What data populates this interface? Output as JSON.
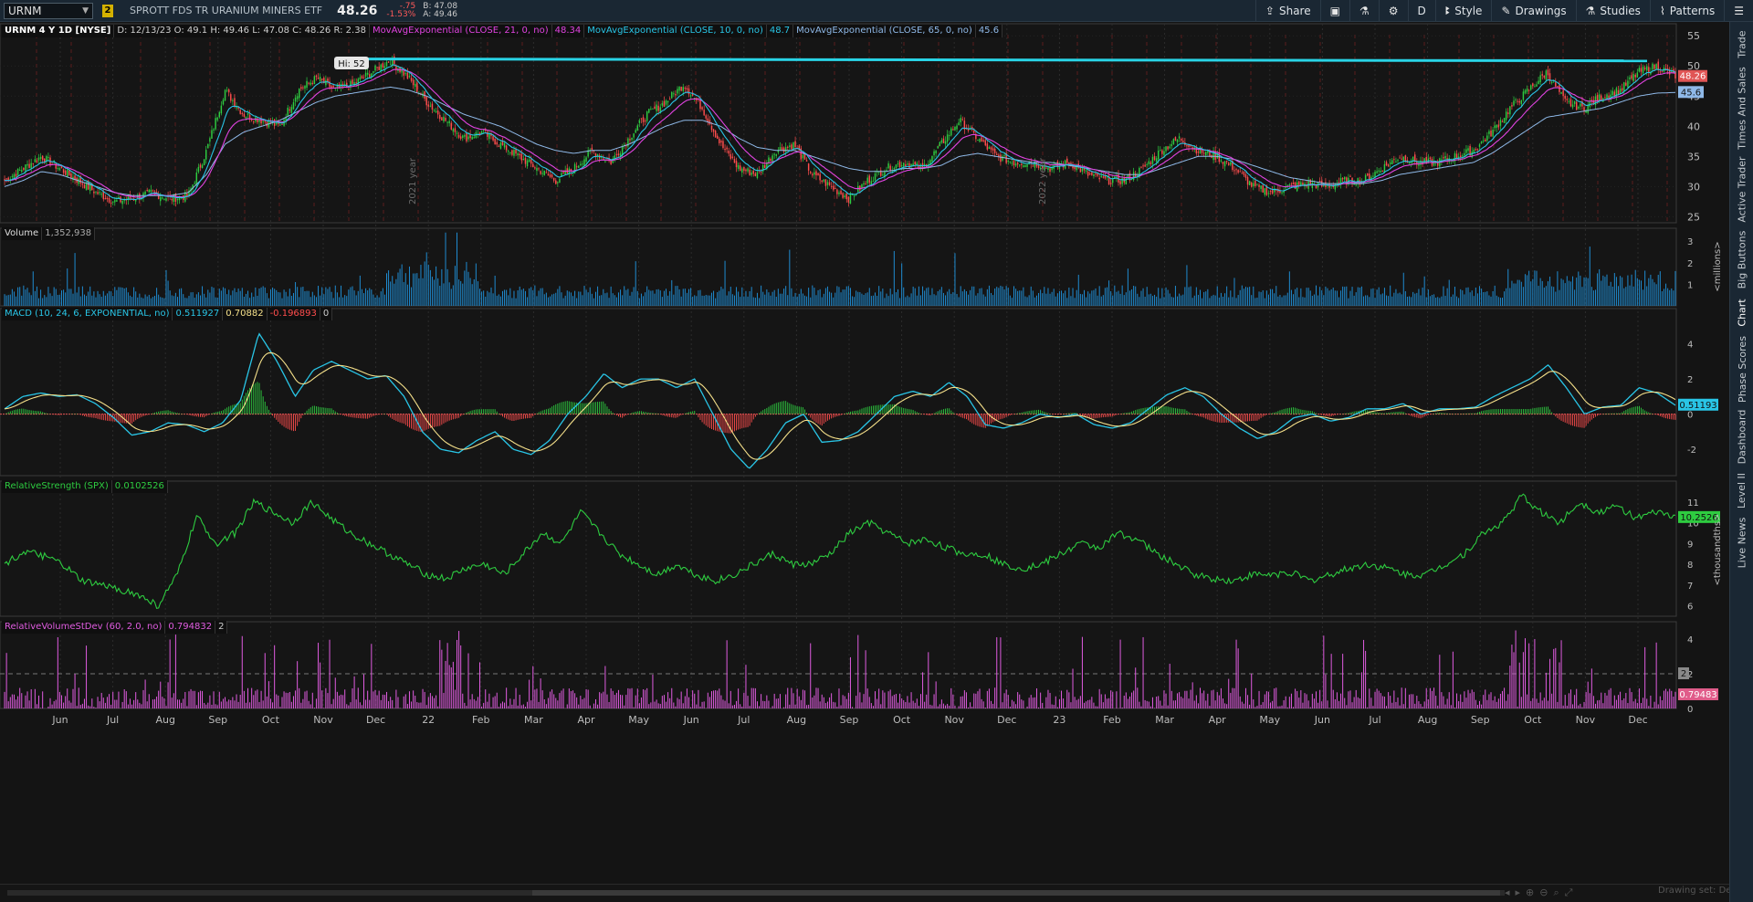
{
  "toolbar": {
    "symbol": "URNM",
    "link_badge": "2",
    "description": "SPROTT FDS TR URANIUM MINERS ETF",
    "last_price": "48.26",
    "change": "-.75",
    "change_pct": "-1.53%",
    "bid": "B: 47.08",
    "ask": "A: 49.46",
    "buttons": [
      {
        "icon": "share-icon",
        "label": "Share"
      },
      {
        "icon": "snapshot-icon",
        "label": ""
      },
      {
        "icon": "flask-icon",
        "label": ""
      },
      {
        "icon": "gear-icon",
        "label": ""
      },
      {
        "icon": "",
        "label": "D"
      },
      {
        "icon": "style-icon",
        "label": "Style"
      },
      {
        "icon": "pencil-icon",
        "label": "Drawings"
      },
      {
        "icon": "flask-icon",
        "label": "Studies"
      },
      {
        "icon": "patterns-icon",
        "label": "Patterns"
      },
      {
        "icon": "menu-icon",
        "label": ""
      }
    ]
  },
  "side_tabs": [
    "Trade",
    "Times And Sales",
    "Active Trader",
    "Big Buttons",
    "Chart",
    "Phase Scores",
    "Dashboard",
    "Level II",
    "Live News"
  ],
  "price_header": {
    "title": "URNM 4 Y 1D [NYSE]",
    "ohlc": "D: 12/13/23  O: 49.1  H: 49.46  L: 47.08  C: 48.26  R: 2.38",
    "ema21_label": "MovAvgExponential (CLOSE, 21, 0, no)",
    "ema21_value": "48.34",
    "ema10_label": "MovAvgExponential (CLOSE, 10, 0, no)",
    "ema10_value": "48.7",
    "ema65_label": "MovAvgExponential (CLOSE, 65, 0, no)",
    "ema65_value": "45.6"
  },
  "volume_header": {
    "label": "Volume",
    "value": "1,352,938"
  },
  "macd_header": {
    "label": "MACD (10, 24, 6, EXPONENTIAL, no)",
    "v1": "0.511927",
    "v2": "0.70882",
    "v3": "-0.196893",
    "v4": "0"
  },
  "rs_header": {
    "label": "RelativeStrength (SPX)",
    "value": "0.0102526"
  },
  "rv_header": {
    "label": "RelativeVolumeStDev (60, 2.0, no)",
    "v1": "0.794832",
    "v2": "2"
  },
  "annotations": {
    "hi_label": "Hi: 52"
  },
  "footer": {
    "drawing_set": "Drawing set: Default"
  },
  "colors": {
    "up": "#2ecc40",
    "down": "#ff4d4d",
    "ema10": "#29c5e6",
    "ema21": "#e043e0",
    "ema65": "#8fb9e8",
    "volume": "#1f8bd0",
    "rs": "#2ecc40",
    "rv": "#e05ce0",
    "resistance": "#29d4e6"
  },
  "chart_data": [
    {
      "type": "candlestick",
      "title": "URNM 4 Y 1D [NYSE]",
      "x_tick_labels": [
        "Jun",
        "Jul",
        "Aug",
        "Sep",
        "Oct",
        "Nov",
        "Dec",
        "22",
        "Feb",
        "Mar",
        "Apr",
        "May",
        "Jun",
        "Jul",
        "Aug",
        "Sep",
        "Oct",
        "Nov",
        "Dec",
        "23",
        "Feb",
        "Mar",
        "Apr",
        "May",
        "Jun",
        "Jul",
        "Aug",
        "Sep",
        "Oct",
        "Nov",
        "Dec"
      ],
      "y_ticks": [
        25,
        30,
        35,
        40,
        45,
        50,
        55
      ],
      "ylim": [
        24,
        57
      ],
      "close_path": [
        31,
        33,
        35,
        33,
        31,
        29,
        27.5,
        28,
        29,
        28,
        28.5,
        36,
        46,
        42,
        41,
        40,
        46,
        48,
        46,
        47,
        49,
        51,
        48,
        44,
        41,
        38,
        39,
        37,
        35,
        33,
        31,
        33,
        36,
        34,
        38,
        42,
        44,
        47,
        43,
        37,
        33,
        32,
        36,
        37,
        32,
        30,
        28,
        31,
        33,
        34,
        33,
        37,
        41,
        38,
        35,
        34,
        34,
        33,
        34,
        32,
        31,
        31,
        33,
        36,
        38,
        36,
        35,
        33,
        30,
        29,
        30,
        30.5,
        30,
        31,
        31,
        33,
        35,
        34,
        34,
        35,
        36,
        39,
        43,
        46,
        49,
        44,
        43,
        45,
        46,
        49,
        50,
        48.26
      ],
      "ema65_path": [
        30,
        31,
        32.5,
        32,
        31,
        30,
        29,
        28.5,
        28.5,
        28.5,
        29,
        32,
        37,
        39,
        40,
        41,
        42.5,
        44,
        45,
        45.5,
        46,
        46.5,
        46,
        45,
        43.5,
        42,
        41,
        40,
        38.5,
        37,
        36,
        35.5,
        36,
        36,
        37,
        38.5,
        40,
        41,
        41,
        40,
        38,
        36.5,
        36,
        36,
        35,
        34,
        33,
        32.5,
        32.5,
        33,
        33,
        33.5,
        35,
        35.5,
        35,
        34.5,
        34,
        34,
        33.5,
        33,
        32.5,
        32,
        32,
        33,
        34,
        35,
        35,
        34.5,
        33.5,
        32.5,
        31.5,
        31,
        30.5,
        30.5,
        30.5,
        31,
        32,
        32.5,
        33,
        33.5,
        34,
        35.5,
        37.5,
        39.5,
        41.5,
        42,
        42.5,
        43,
        44,
        45,
        45.5,
        45.6
      ],
      "levels": [
        {
          "name": "resistance",
          "value": 51
        }
      ],
      "annotations": [
        "Hi: 52"
      ],
      "last_value_labels": [
        "48.26",
        "45.6"
      ]
    },
    {
      "type": "bar",
      "title": "Volume",
      "y_ticks": [
        1,
        2,
        3
      ],
      "ylabel": "<millions>",
      "ylim": [
        0,
        3.6
      ]
    },
    {
      "type": "line",
      "title": "MACD (10, 24, 6, EXPONENTIAL, no)",
      "y_ticks": [
        -2,
        0,
        2,
        4
      ],
      "ylim": [
        -3.5,
        6
      ],
      "macd_path": [
        0.3,
        1.0,
        1.2,
        1.0,
        1.1,
        0.6,
        -0.2,
        -1.2,
        -1.0,
        -0.5,
        -0.6,
        -1.0,
        -0.5,
        0.8,
        4.6,
        3.0,
        1.0,
        2.5,
        3.0,
        2.5,
        2.0,
        2.2,
        1.0,
        -1.0,
        -2.0,
        -2.2,
        -1.5,
        -1.0,
        -2.0,
        -2.3,
        -1.5,
        0.0,
        1.0,
        2.3,
        1.5,
        2.0,
        2.0,
        1.5,
        2.0,
        0.0,
        -2.0,
        -3.1,
        -2.0,
        -0.5,
        0.0,
        -1.6,
        -1.5,
        -1.0,
        0.0,
        1.0,
        1.3,
        1.0,
        1.8,
        1.0,
        -0.6,
        -0.8,
        -0.5,
        0.0,
        -0.2,
        0.0,
        -0.6,
        -0.8,
        -0.5,
        0.3,
        1.1,
        1.5,
        1.0,
        0.0,
        -0.8,
        -1.4,
        -1.0,
        -0.2,
        0.0,
        -0.4,
        -0.2,
        0.3,
        0.3,
        0.6,
        0.0,
        0.3,
        0.3,
        0.4,
        1.0,
        1.5,
        2.0,
        2.8,
        1.5,
        0.0,
        0.4,
        0.5,
        1.5,
        1.2,
        0.5
      ],
      "last_value_label": "0.51193"
    },
    {
      "type": "line",
      "title": "RelativeStrength (SPX)",
      "y_ticks": [
        6,
        7,
        8,
        9,
        10,
        11
      ],
      "ylabel": "<thousandths>",
      "ylim": [
        5.5,
        12
      ],
      "path": [
        8,
        8.6,
        8.4,
        8,
        7.2,
        7,
        6.8,
        6.5,
        6.0,
        7.5,
        10.3,
        9,
        9.5,
        11,
        10.5,
        10,
        11,
        10.2,
        9.5,
        9,
        8.5,
        8,
        7.5,
        7.3,
        7.8,
        8,
        7.5,
        8.5,
        9.5,
        9,
        10.5,
        9.5,
        8.5,
        8,
        7.5,
        8,
        7.5,
        7.2,
        7.5,
        8,
        8.5,
        8,
        8,
        8.5,
        9.5,
        10,
        9.5,
        9,
        9.2,
        8.8,
        8.5,
        8.5,
        8,
        7.8,
        8,
        8.5,
        9,
        8.8,
        9.5,
        9.2,
        8.5,
        8,
        7.5,
        7.3,
        7.2,
        7.5,
        7.5,
        7.6,
        7.2,
        7.5,
        7.8,
        8,
        7.8,
        7.5,
        7.5,
        8,
        8.5,
        9.5,
        10,
        11.3,
        10.5,
        10.0,
        11.0,
        10.5,
        10.8,
        10.2,
        10.5,
        10.3
      ],
      "last_value_label": "10.2526"
    },
    {
      "type": "bar",
      "title": "RelativeVolumeStDev (60, 2.0, no)",
      "y_ticks": [
        0,
        2,
        4
      ],
      "ylim": [
        0,
        5
      ],
      "levels": [
        {
          "name": "threshold",
          "value": 2
        }
      ],
      "last_value_labels": [
        "2",
        "0.79483"
      ]
    }
  ]
}
